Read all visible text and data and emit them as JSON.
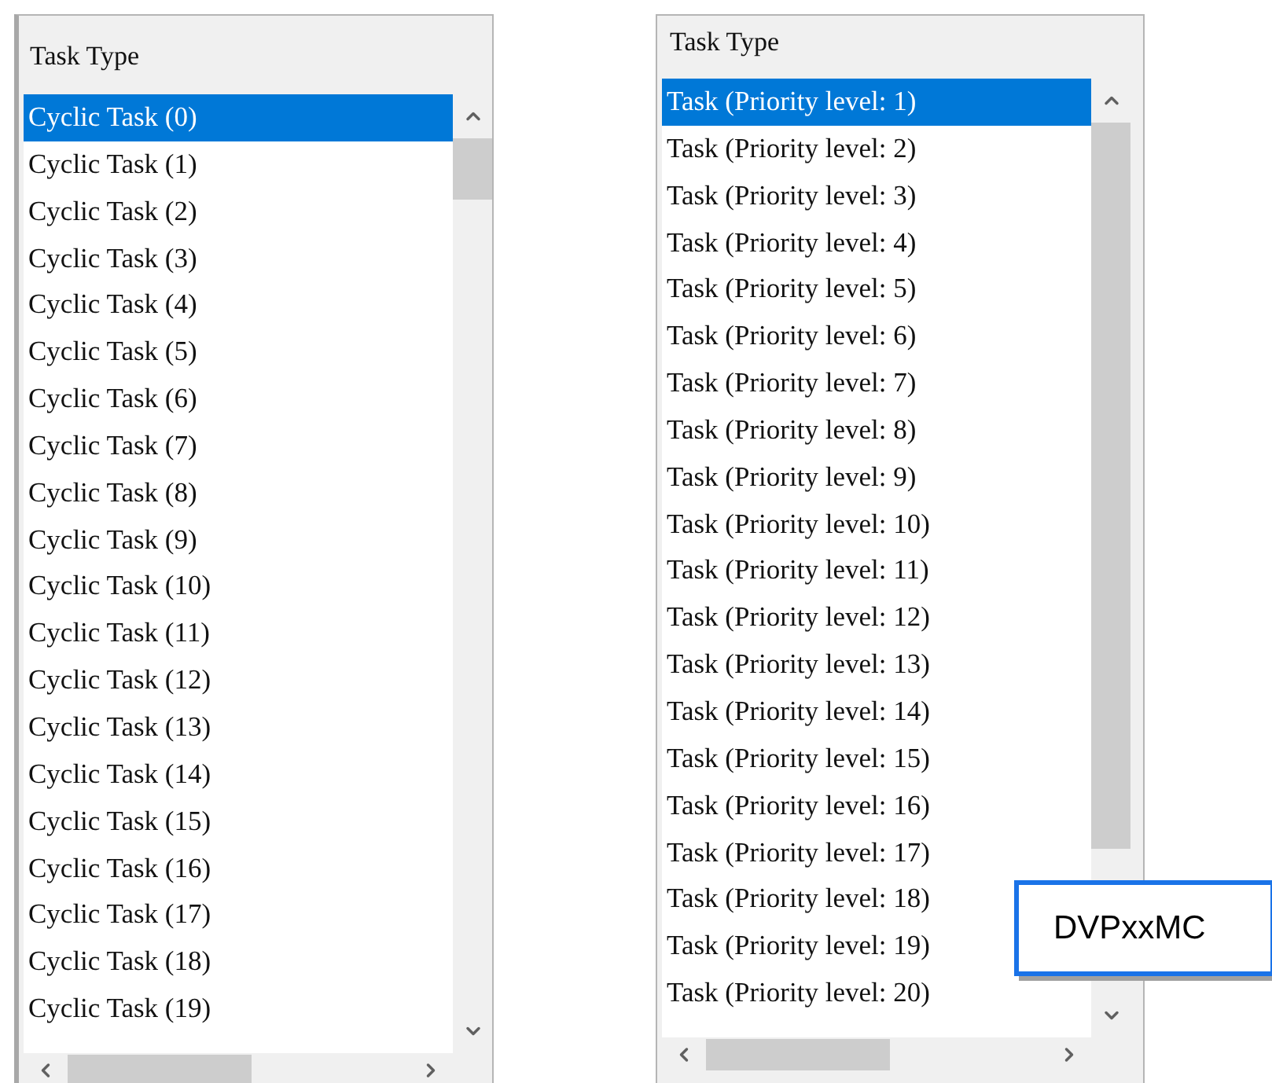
{
  "panels": [
    {
      "title": "Task Type",
      "items": [
        {
          "label": "Cyclic Task (0)",
          "selected": true
        },
        {
          "label": "Cyclic Task (1)",
          "selected": false
        },
        {
          "label": "Cyclic Task (2)",
          "selected": false
        },
        {
          "label": "Cyclic Task (3)",
          "selected": false
        },
        {
          "label": "Cyclic Task (4)",
          "selected": false
        },
        {
          "label": "Cyclic Task (5)",
          "selected": false
        },
        {
          "label": "Cyclic Task (6)",
          "selected": false
        },
        {
          "label": "Cyclic Task (7)",
          "selected": false
        },
        {
          "label": "Cyclic Task (8)",
          "selected": false
        },
        {
          "label": "Cyclic Task (9)",
          "selected": false
        },
        {
          "label": "Cyclic Task (10)",
          "selected": false
        },
        {
          "label": "Cyclic Task (11)",
          "selected": false
        },
        {
          "label": "Cyclic Task (12)",
          "selected": false
        },
        {
          "label": "Cyclic Task (13)",
          "selected": false
        },
        {
          "label": "Cyclic Task (14)",
          "selected": false
        },
        {
          "label": "Cyclic Task (15)",
          "selected": false
        },
        {
          "label": "Cyclic Task (16)",
          "selected": false
        },
        {
          "label": "Cyclic Task (17)",
          "selected": false
        },
        {
          "label": "Cyclic Task (18)",
          "selected": false
        },
        {
          "label": "Cyclic Task (19)",
          "selected": false
        }
      ]
    },
    {
      "title": "Task Type",
      "items": [
        {
          "label": "Task (Priority level: 1)",
          "selected": true
        },
        {
          "label": "Task (Priority level: 2)",
          "selected": false
        },
        {
          "label": "Task (Priority level: 3)",
          "selected": false
        },
        {
          "label": "Task (Priority level: 4)",
          "selected": false
        },
        {
          "label": "Task (Priority level: 5)",
          "selected": false
        },
        {
          "label": "Task (Priority level: 6)",
          "selected": false
        },
        {
          "label": "Task (Priority level: 7)",
          "selected": false
        },
        {
          "label": "Task (Priority level: 8)",
          "selected": false
        },
        {
          "label": "Task (Priority level: 9)",
          "selected": false
        },
        {
          "label": "Task (Priority level: 10)",
          "selected": false
        },
        {
          "label": "Task (Priority level: 11)",
          "selected": false
        },
        {
          "label": "Task (Priority level: 12)",
          "selected": false
        },
        {
          "label": "Task (Priority level: 13)",
          "selected": false
        },
        {
          "label": "Task (Priority level: 14)",
          "selected": false
        },
        {
          "label": "Task (Priority level: 15)",
          "selected": false
        },
        {
          "label": "Task (Priority level: 16)",
          "selected": false
        },
        {
          "label": "Task (Priority level: 17)",
          "selected": false
        },
        {
          "label": "Task (Priority level: 18)",
          "selected": false
        },
        {
          "label": "Task (Priority level: 19)",
          "selected": false
        },
        {
          "label": "Task (Priority level: 20)",
          "selected": false
        }
      ]
    }
  ],
  "callout": {
    "label": "DVPxxMC"
  }
}
